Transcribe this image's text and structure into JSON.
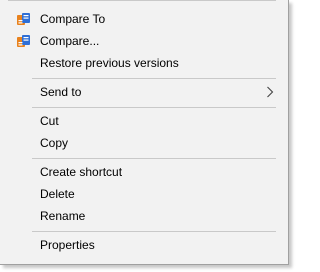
{
  "menu": {
    "groups": [
      {
        "items": [
          {
            "label": "Compare To",
            "icon": "compare-app-icon"
          },
          {
            "label": "Compare...",
            "icon": "compare-app-icon"
          },
          {
            "label": "Restore previous versions"
          }
        ]
      },
      {
        "items": [
          {
            "label": "Send to",
            "submenu_icon": "chevron-right-icon"
          }
        ]
      },
      {
        "items": [
          {
            "label": "Cut"
          },
          {
            "label": "Copy"
          }
        ]
      },
      {
        "items": [
          {
            "label": "Create shortcut"
          },
          {
            "label": "Delete"
          },
          {
            "label": "Rename"
          }
        ]
      },
      {
        "items": [
          {
            "label": "Properties"
          }
        ]
      }
    ],
    "colors": {
      "background": "#f2f2f2",
      "separator": "#c9c9c9",
      "border": "#a0a0a0",
      "icon_orange": "#e8821e",
      "icon_blue": "#2f6fd6"
    }
  }
}
